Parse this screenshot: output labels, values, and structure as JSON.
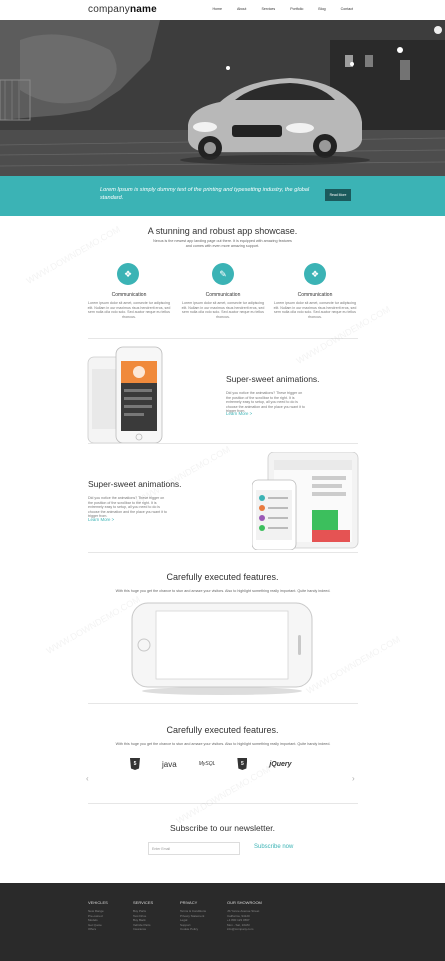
{
  "header": {
    "logo_light": "company",
    "logo_bold": "name",
    "nav": [
      "Home",
      "About",
      "Services",
      "Portfolio",
      "Blog",
      "Contact"
    ]
  },
  "banner": {
    "text": "Lorem Ipsum is simply dummy text of the printing and typesetting industry, the global standard.",
    "button": "Read More"
  },
  "showcase": {
    "title": "A stunning and robust app showcase.",
    "subtitle": "Nexus is the newest app landing page out there. It is equipped with amazing features and comes with even more amazing support.",
    "features": [
      {
        "title": "Communication",
        "text": "Lorem ipsum dolor sit amet, consecte tur adipiscing elit. Nullam in our maximus risus hendrerit eros, sed sem nulla olla volo solo. Sed auctor neque eu tellus rhoncus."
      },
      {
        "title": "Communication",
        "text": "Lorem ipsum dolor sit amet, consecte tur adipiscing elit. Nullam in our maximus risus hendrerit eros, sed sem nulla olla volo solo. Sed auctor neque eu tellus rhoncus."
      },
      {
        "title": "Communication",
        "text": "Lorem ipsum dolor sit amet, consecte tur adipiscing elit. Nullam in our maximus risus hendrerit eros, sed sem nulla olla volo solo. Sed auctor neque eu tellus rhoncus."
      }
    ]
  },
  "animations_1": {
    "title": "Super-sweet animations.",
    "text": "Did you notice the animations? These trigger on the position of the scrollbar to the right. It is extremely easy to setup, all you need to do is choose the animation and the place you want it to trigger from.",
    "link": "Learn More >"
  },
  "animations_2": {
    "title": "Super-sweet animations.",
    "text": "Did you notice the animations? These trigger on the position of the scrollbar to the right. It is extremely easy to setup, all you need to do is choose the animation and the place you want it to trigger from.",
    "link": "Learn More >"
  },
  "executed_1": {
    "title": "Carefully executed features.",
    "text": "With this huge you get the chance to stun and amaze your visitors. Also to highlight something really important. Quite handy indeed."
  },
  "executed_2": {
    "title": "Carefully executed features.",
    "text": "With this huge you get the chance to stun and amaze your visitors. Also to highlight something really important. Quite handy indeed."
  },
  "logos": [
    "5",
    "java",
    "MySQL",
    "5",
    "jQuery"
  ],
  "arrows": {
    "prev": "‹",
    "next": "›"
  },
  "newsletter": {
    "title": "Subscribe to our newsletter.",
    "placeholder": "Enter Email",
    "button": "Subscribe now"
  },
  "footer": {
    "columns": [
      {
        "title": "VEHICLES",
        "items": [
          "New Range",
          "Pre-owned",
          "Models",
          "Get Quote",
          "Offers"
        ]
      },
      {
        "title": "SERVICES",
        "items": [
          "Buy Parts",
          "Test Drive",
          "Buy Back",
          "Vehicle Parts",
          "Insurance"
        ]
      },
      {
        "title": "PRIVACY",
        "items": [
          "Terms & Conditions",
          "Privacy Statement",
          "Legal",
          "Support",
          "Cookie Policy"
        ]
      },
      {
        "title": "OUR SHOWROOM",
        "items": [
          "JS Yonne Avenue Street",
          "California, 94120",
          "+1 800 123 4567",
          "Mon - Sat, 10AM",
          "info@company.com"
        ]
      }
    ]
  },
  "watermark": "WWW.DOWNDEMO.COM",
  "colors": {
    "accent": "#3bb3b5",
    "footer": "#2a2a2a",
    "banner_button": "#1b5a5c"
  }
}
